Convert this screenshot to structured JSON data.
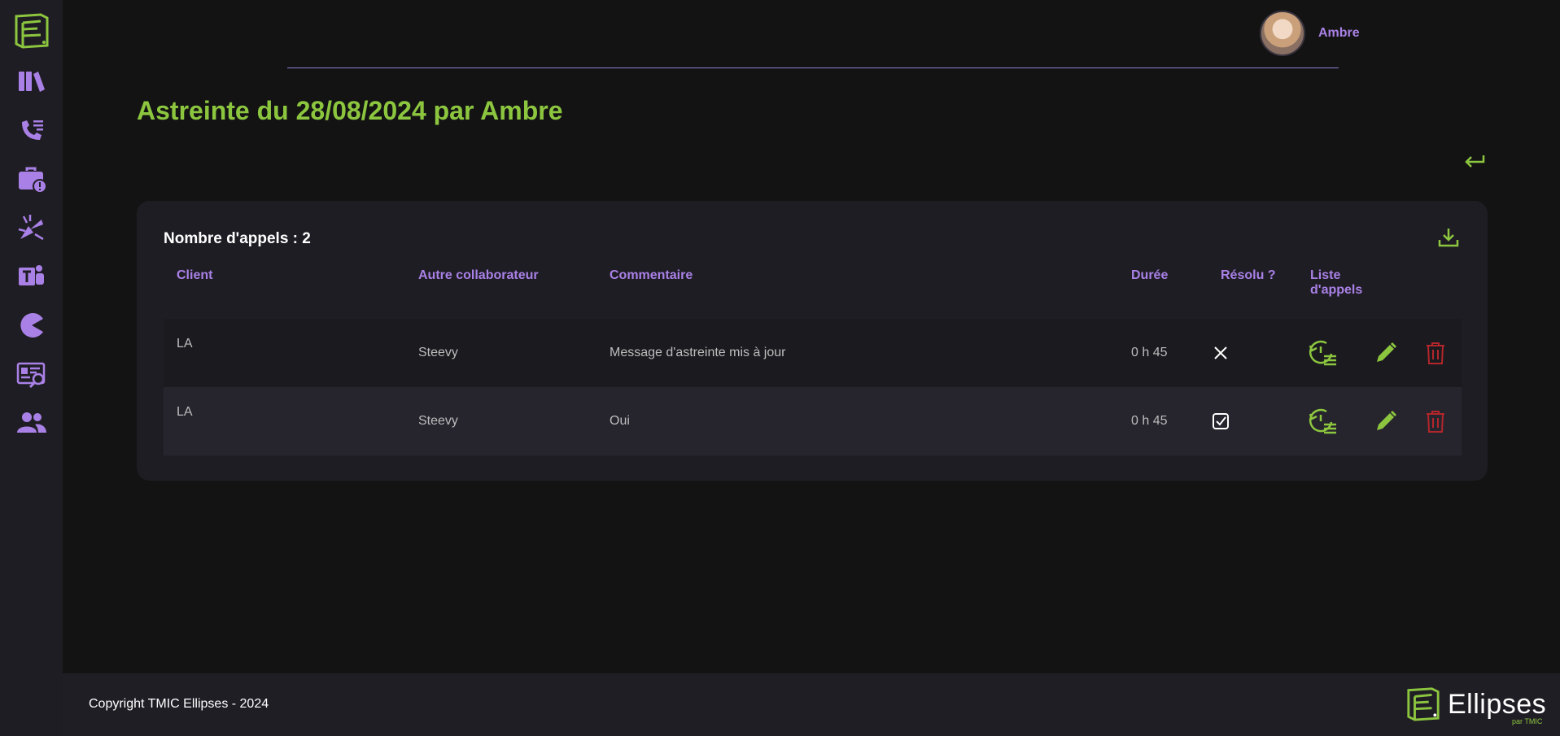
{
  "app": {
    "brand_name": "Ellipses",
    "brand_sub": "par TMIC",
    "accent": "#8cc63f",
    "secondary": "#a981e6",
    "danger": "#b3262b"
  },
  "sidebar": {
    "items": [
      {
        "icon": "books-icon"
      },
      {
        "icon": "phone-list-icon"
      },
      {
        "icon": "briefcase-alert-icon"
      },
      {
        "icon": "bug-icon"
      },
      {
        "icon": "teams-icon"
      },
      {
        "icon": "pacman-icon"
      },
      {
        "icon": "report-search-icon"
      },
      {
        "icon": "users-icon"
      }
    ]
  },
  "header": {
    "user_name": "Ambre"
  },
  "page": {
    "title": "Astreinte du 28/08/2024 par Ambre"
  },
  "calls": {
    "count_label": "Nombre d'appels : 2",
    "columns": {
      "client": "Client",
      "other": "Autre collaborateur",
      "comment": "Commentaire",
      "duration": "Durée",
      "resolved": "Résolu ?",
      "list_line1": "Liste",
      "list_line2": "d'appels"
    },
    "rows": [
      {
        "client": "LA",
        "other": "Steevy",
        "comment": "Message d'astreinte mis à jour",
        "duration": "0 h 45",
        "resolved": false
      },
      {
        "client": "LA",
        "other": "Steevy",
        "comment": "Oui",
        "duration": "0 h 45",
        "resolved": true
      }
    ]
  },
  "footer": {
    "copyright": "Copyright TMIC Ellipses - 2024"
  }
}
